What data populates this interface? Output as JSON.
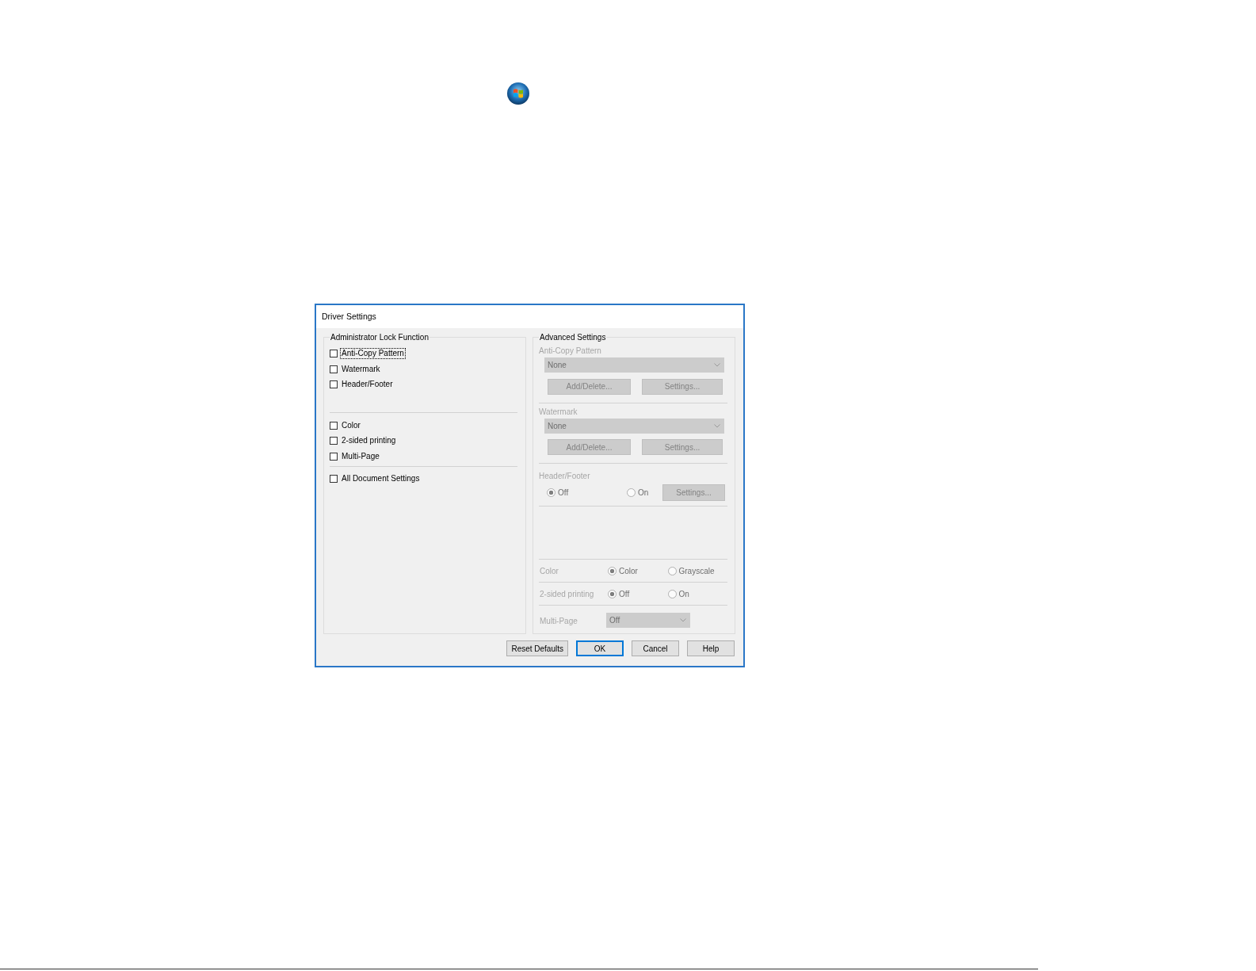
{
  "dialog": {
    "title": "Driver Settings",
    "administrator_lock_function": {
      "title": "Administrator Lock Function",
      "sections": [
        {
          "items": [
            {
              "label": "Anti-Copy Pattern",
              "checked": false,
              "focused": true
            },
            {
              "label": "Watermark",
              "checked": false,
              "focused": false
            },
            {
              "label": "Header/Footer",
              "checked": false,
              "focused": false
            }
          ]
        },
        {
          "items": [
            {
              "label": "Color",
              "checked": false,
              "focused": false
            },
            {
              "label": "2-sided printing",
              "checked": false,
              "focused": false
            },
            {
              "label": "Multi-Page",
              "checked": false,
              "focused": false
            }
          ]
        },
        {
          "items": [
            {
              "label": "All Document Settings",
              "checked": false,
              "focused": false
            }
          ]
        }
      ]
    },
    "advanced_settings": {
      "title": "Advanced Settings",
      "disabled": true,
      "sections": [
        {
          "kind": "select_buttons",
          "label": "Anti-Copy Pattern",
          "value": "None",
          "buttons": [
            "Add/Delete...",
            "Settings..."
          ]
        },
        {
          "kind": "select_buttons",
          "label": "Watermark",
          "value": "None",
          "buttons": [
            "Add/Delete...",
            "Settings..."
          ]
        },
        {
          "kind": "radio_button",
          "label": "Header/Footer",
          "options": [
            {
              "label": "Off",
              "selected": true
            },
            {
              "label": "On",
              "selected": false
            }
          ],
          "button": "Settings..."
        },
        {
          "kind": "radio_row",
          "label": "Color",
          "options": [
            {
              "label": "Color",
              "selected": true
            },
            {
              "label": "Grayscale",
              "selected": false
            }
          ]
        },
        {
          "kind": "radio_row",
          "label": "2-sided printing",
          "options": [
            {
              "label": "Off",
              "selected": true
            },
            {
              "label": "On",
              "selected": false
            }
          ]
        },
        {
          "kind": "select_row",
          "label": "Multi-Page",
          "value": "Off"
        }
      ]
    },
    "buttons": [
      {
        "label": "Reset Defaults",
        "default": false
      },
      {
        "label": "OK",
        "default": true
      },
      {
        "label": "Cancel",
        "default": false
      },
      {
        "label": "Help",
        "default": false
      }
    ]
  }
}
